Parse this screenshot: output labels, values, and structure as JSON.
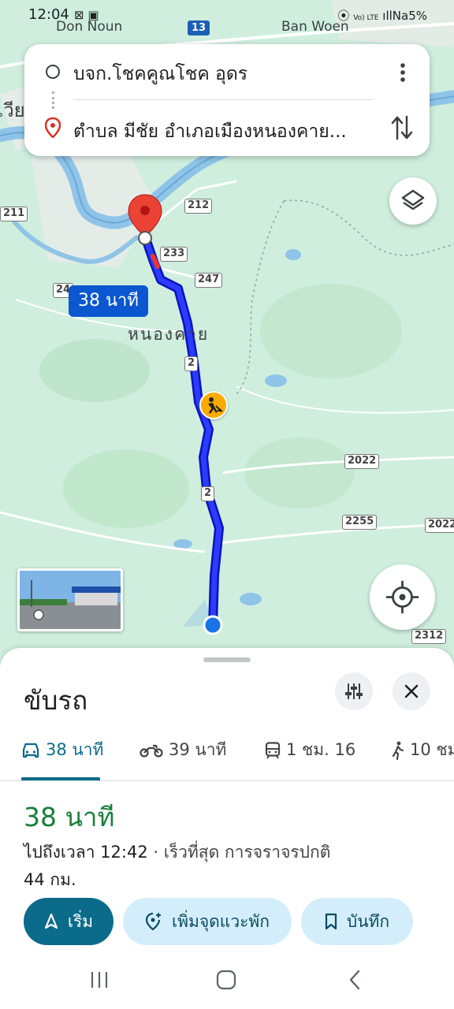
{
  "status_bar": {
    "time": "12:04",
    "carrier_text": "Vo) LTE",
    "right_text": "ıllNa5%"
  },
  "map": {
    "place_labels": {
      "don_noun": "Don Noun",
      "ban_woen": "Ban Woen",
      "city": "หนองคาย",
      "vie_fragment": "เวีย"
    },
    "road_shields": {
      "r13": "13",
      "r212": "212",
      "r211": "211",
      "r233": "233",
      "r247": "247",
      "r24": "24",
      "r2_a": "2",
      "r2_b": "2",
      "r2022_a": "2022",
      "r2022_b": "2022",
      "r2255": "2255",
      "r2312": "2312"
    },
    "route_time_chip": "38 นาที"
  },
  "route_card": {
    "origin": "บจก.โชคคูณโชค อุดร",
    "destination": "ตำบล มีชัย อำเภอเมืองหนองคาย..."
  },
  "sheet": {
    "title": "ขับรถ",
    "tabs": [
      {
        "mode": "car",
        "label": "38 นาที",
        "active": true
      },
      {
        "mode": "motorcycle",
        "label": "39 นาที",
        "active": false
      },
      {
        "mode": "transit",
        "label": "1 ชม. 16",
        "active": false
      },
      {
        "mode": "walk",
        "label": "10 ชม",
        "active": false
      }
    ],
    "duration": "38 นาที",
    "eta": "ไปถึงเวลา 12:42",
    "eta_detail": " · เร็วที่สุด การจราจรปกติ",
    "distance": "44 กม.",
    "buttons": {
      "start": "เริ่ม",
      "add_stop": "เพิ่มจุดแวะพัก",
      "save": "บันทึก"
    }
  },
  "colors": {
    "route": "#1a1aff",
    "accent": "#0b6b8a",
    "duration_green": "#188038",
    "map_bg": "#cfeede"
  }
}
